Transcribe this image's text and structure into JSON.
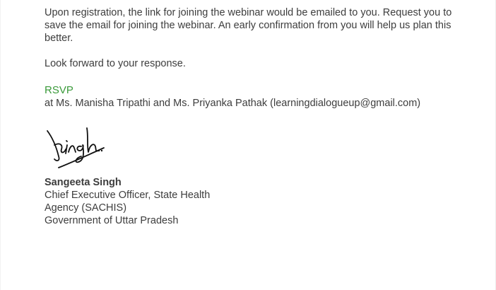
{
  "letter": {
    "paragraph1": "Upon registration, the link for joining the webinar would be emailed to you. Request you to save the email for joining the webinar. An early confirmation from you will help us plan this better.",
    "paragraph2": "Look forward to your response.",
    "rsvp_label": "RSVP",
    "rsvp_contacts": "at Ms. Manisha Tripathi and Ms. Priyanka Pathak (learningdialogueup@gmail.com)"
  },
  "signature_block": {
    "name": "Sangeeta Singh",
    "title": "Chief Executive Officer, State Health Agency (SACHIS)",
    "organization": "Government of Uttar Pradesh"
  },
  "colors": {
    "text": "#3d3d3d",
    "rsvp": "#3a9a3a",
    "signature_ink": "#111111"
  }
}
